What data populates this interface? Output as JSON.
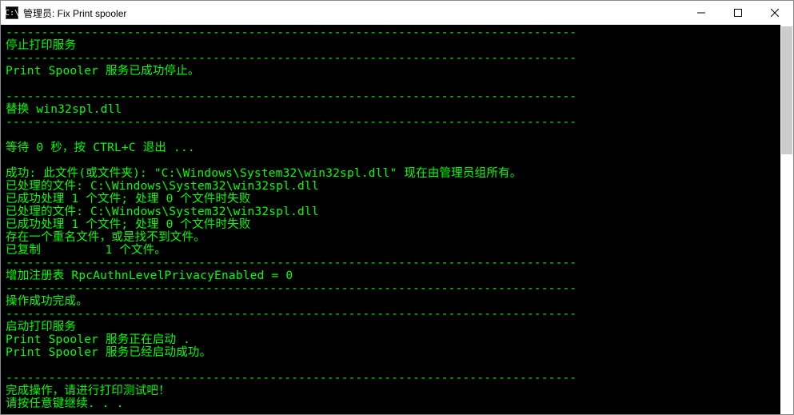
{
  "titlebar": {
    "icon_label": "C:\\",
    "title": "管理员: Fix Print spooler",
    "minimize": "—",
    "maximize": "□",
    "close": "✕"
  },
  "console": {
    "lines": [
      "--------------------------------------------------------------------------------",
      "停止打印服务",
      "--------------------------------------------------------------------------------",
      "Print Spooler 服务已成功停止。",
      "",
      "--------------------------------------------------------------------------------",
      "替换 win32spl.dll",
      "--------------------------------------------------------------------------------",
      "",
      "等待 0 秒，按 CTRL+C 退出 ...",
      "",
      "成功: 此文件(或文件夹): \"C:\\Windows\\System32\\win32spl.dll\" 现在由管理员组所有。",
      "已处理的文件: C:\\Windows\\System32\\win32spl.dll",
      "已成功处理 1 个文件; 处理 0 个文件时失败",
      "已处理的文件: C:\\Windows\\System32\\win32spl.dll",
      "已成功处理 1 个文件; 处理 0 个文件时失败",
      "存在一个重名文件，或是找不到文件。",
      "已复制         1 个文件。",
      "--------------------------------------------------------------------------------",
      "增加注册表 RpcAuthnLevelPrivacyEnabled = 0",
      "--------------------------------------------------------------------------------",
      "操作成功完成。",
      "--------------------------------------------------------------------------------",
      "启动打印服务",
      "Print Spooler 服务正在启动 .",
      "Print Spooler 服务已经启动成功。",
      "",
      "--------------------------------------------------------------------------------",
      "完成操作，请进行打印测试吧！",
      "请按任意键继续. . ."
    ]
  }
}
